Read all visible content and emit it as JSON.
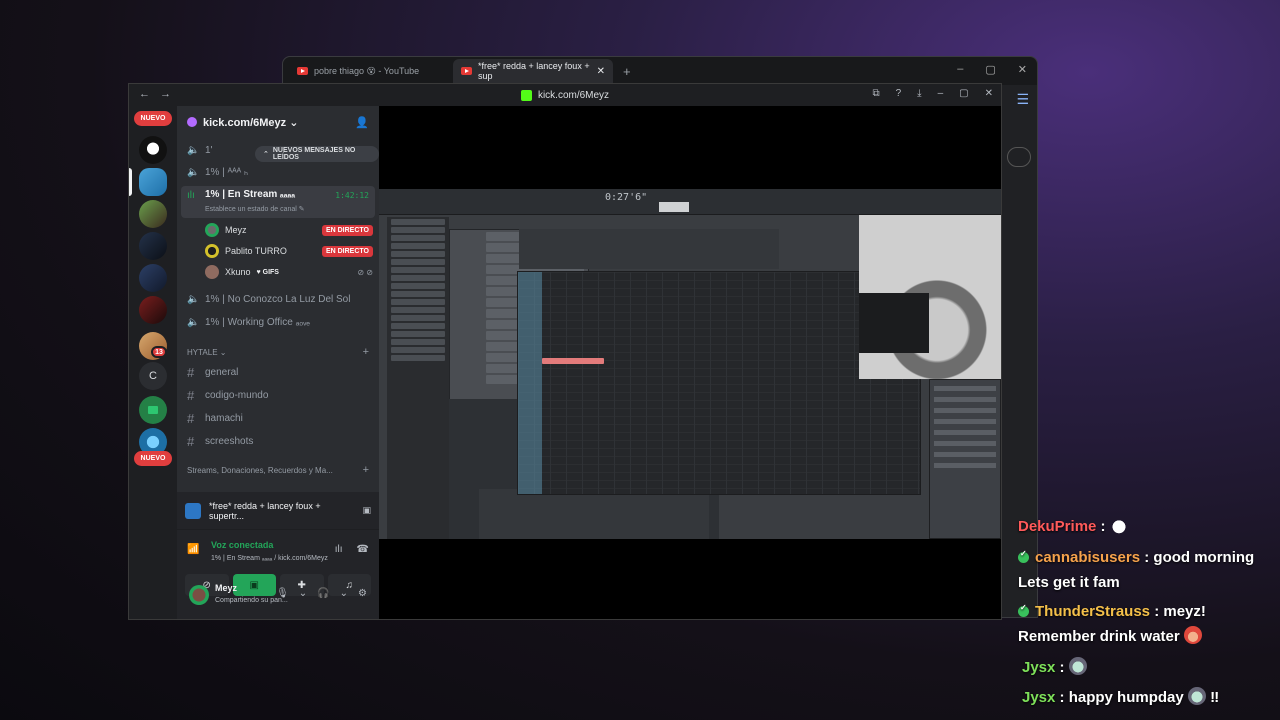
{
  "browser_back": {
    "tabs": [
      {
        "label": "pobre thiago 😵 - YouTube",
        "icon": "youtube-icon"
      },
      {
        "label": "*free* redda + lancey foux + sup",
        "icon": "youtube-icon"
      }
    ],
    "controls": [
      "–",
      "▢",
      "✕"
    ]
  },
  "front": {
    "nav_back": "←",
    "nav_forward": "→",
    "url": "kick.com/6Meyz",
    "window_controls": [
      "–",
      "▢",
      "✕"
    ]
  },
  "rail": {
    "nuevo_top": "NUEVO",
    "nuevo_bottom": "NUEVO",
    "badge_count": "13",
    "letter_server": "C"
  },
  "server": {
    "name": "kick.com/6Meyz ⌄",
    "new_messages": "NUEVOS MENSAJES NO LEÍDOS",
    "voice_channels_top": [
      {
        "label": "1'"
      },
      {
        "label": "1% | ᴬᴬᴬ ₕ"
      }
    ],
    "live_channel": {
      "name": "1% | En Stream ₐₐₐₐ",
      "time": "1:42:12",
      "status": "Establece un estado de canal ✎"
    },
    "members": [
      {
        "name": "Meyz",
        "badge": "EN DIRECTO"
      },
      {
        "name": "Pablito TURRO",
        "badge": "EN DIRECTO"
      },
      {
        "name": "Xkuno",
        "badge": "♥ GIFS"
      }
    ],
    "voice_channels_bottom": [
      {
        "label": "1% | No Conozco La Luz Del Sol"
      },
      {
        "label": "1% | Working Office ₐₒᵥₑ"
      }
    ],
    "category_1": "HYTALE ⌄",
    "text_channels": [
      "general",
      "codigo-mundo",
      "hamachi",
      "screeshots"
    ],
    "category_2": "Streams, Donaciones, Recuerdos y Ma..."
  },
  "stream_card": {
    "title": "*free* redda + lancey foux + supertr...",
    "voice_status": "Voz conectada",
    "voice_channel": "1% | En Stream ₐₐₐₐ / kick.com/6Meyz",
    "user_name": "Meyz",
    "user_status": "Compartiendo su pan..."
  },
  "daw": {
    "time": "0:27'6\""
  },
  "chat": {
    "messages": [
      {
        "user": "DekuPrime",
        "sep": " :",
        "text": "",
        "color": "#ff5a5a",
        "verified": false,
        "emote": "duck-emote"
      },
      {
        "user": "cannabisusers",
        "sep": " :",
        "text": " good morning",
        "color": "#f6a24c",
        "verified": true
      },
      {
        "user": "",
        "sep": "",
        "text": "Lets get it fam",
        "color": "#ffffff",
        "verified": false
      },
      {
        "user": "ThunderStrauss",
        "sep": " :",
        "text": " meyz!",
        "color": "#f4c04a",
        "verified": true
      },
      {
        "user": "",
        "sep": "",
        "text": "Remember drink water",
        "color": "#ffffff",
        "verified": false,
        "emote": "girl-emote"
      },
      {
        "user": "Jysx",
        "sep": " :",
        "text": "",
        "color": "#7ee05a",
        "verified": false,
        "emote": "alien-emote"
      },
      {
        "user": "Jysx",
        "sep": " :",
        "text": " happy humpday",
        "color": "#7ee05a",
        "verified": false,
        "emote": "alien-emote",
        "suffix": " ‼"
      }
    ]
  }
}
